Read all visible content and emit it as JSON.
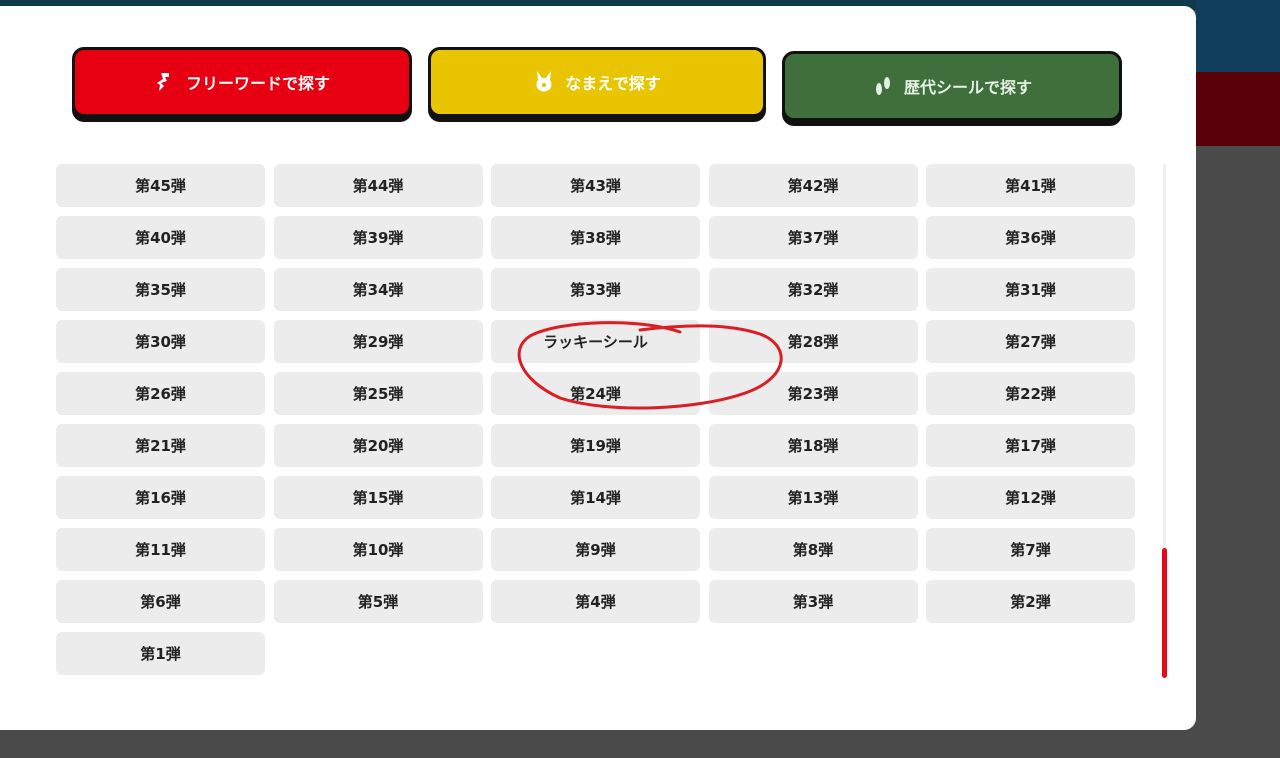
{
  "tabs": {
    "freeword": {
      "label": "フリーワードで探す",
      "icon": "pointing-hand-icon",
      "color": "#e60012"
    },
    "name": {
      "label": "なまえで探す",
      "icon": "character-icon",
      "color": "#e8c500"
    },
    "history": {
      "label": "歴代シールで探す",
      "icon": "footprint-icon",
      "color": "#3f6f3b"
    }
  },
  "sets": [
    "第45弾",
    "第44弾",
    "第43弾",
    "第42弾",
    "第41弾",
    "第40弾",
    "第39弾",
    "第38弾",
    "第37弾",
    "第36弾",
    "第35弾",
    "第34弾",
    "第33弾",
    "第32弾",
    "第31弾",
    "第30弾",
    "第29弾",
    "ラッキーシール",
    "第28弾",
    "第27弾",
    "第26弾",
    "第25弾",
    "第24弾",
    "第23弾",
    "第22弾",
    "第21弾",
    "第20弾",
    "第19弾",
    "第18弾",
    "第17弾",
    "第16弾",
    "第15弾",
    "第14弾",
    "第13弾",
    "第12弾",
    "第11弾",
    "第10弾",
    "第9弾",
    "第8弾",
    "第7弾",
    "第6弾",
    "第5弾",
    "第4弾",
    "第3弾",
    "第2弾",
    "第1弾"
  ],
  "colors": {
    "annotation": "#d81f26",
    "scroll_thumb": "#e6081a"
  }
}
